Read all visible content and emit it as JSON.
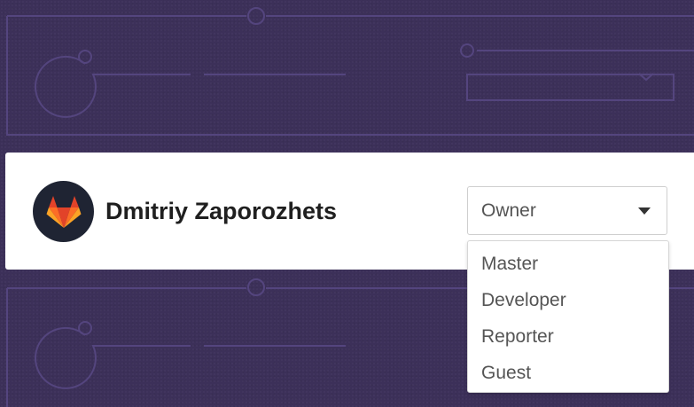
{
  "member": {
    "name": "Dmitriy Zaporozhets",
    "avatar_icon": "gitlab-tanuki-icon"
  },
  "role_select": {
    "selected": "Owner",
    "caret_icon": "caret-down-icon",
    "options": [
      "Master",
      "Developer",
      "Reporter",
      "Guest"
    ]
  },
  "colors": {
    "background": "#3c3059",
    "decor_line": "#54457e",
    "card": "#ffffff",
    "avatar_bg": "#1f2433",
    "logo_orange": "#e24329",
    "logo_light": "#fc6d26",
    "logo_amber": "#fca326"
  }
}
